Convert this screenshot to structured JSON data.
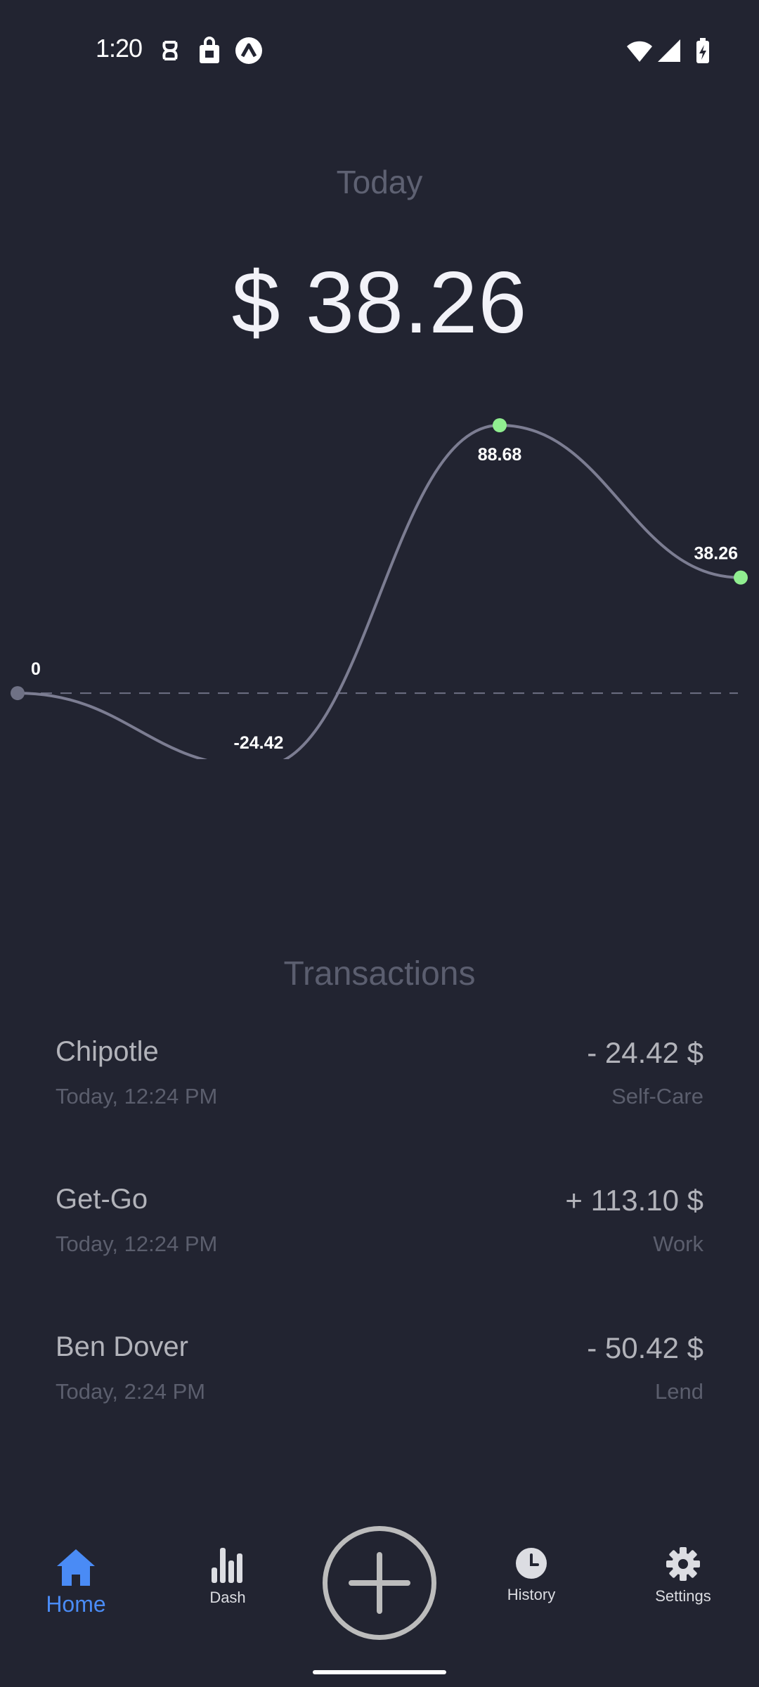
{
  "status_bar": {
    "time": "1:20",
    "left_icons": [
      "notification-icon",
      "shopping-bag-icon",
      "app-icon"
    ],
    "right_icons": [
      "wifi-icon",
      "signal-icon",
      "battery-charging-icon"
    ]
  },
  "summary": {
    "period": "Today",
    "balance": "$ 38.26"
  },
  "chart_data": {
    "type": "line",
    "x": [
      0,
      1,
      2,
      3
    ],
    "values": [
      0,
      -24.42,
      88.68,
      38.26
    ],
    "labels": [
      "0",
      "-24.42",
      "88.68",
      "38.26"
    ],
    "point_colors": [
      "#6f7185",
      "#ff0000",
      "#90ee90",
      "#90ee90"
    ],
    "line_color": "#7c7d92",
    "baseline": 0,
    "baseline_style": "dashed",
    "grid": false
  },
  "transactions": {
    "title": "Transactions",
    "items": [
      {
        "name": "Chipotle",
        "date": "Today, 12:24 PM",
        "amount": "- 24.42 $",
        "category": "Self-Care"
      },
      {
        "name": "Get-Go",
        "date": "Today, 12:24 PM",
        "amount": "+ 113.10 $",
        "category": "Work"
      },
      {
        "name": "Ben Dover",
        "date": "Today, 2:24 PM",
        "amount": "- 50.42 $",
        "category": "Lend"
      }
    ]
  },
  "nav": {
    "home": "Home",
    "dash": "Dash",
    "history": "History",
    "settings": "Settings",
    "active": "Home",
    "active_color": "#4a8bf5"
  }
}
